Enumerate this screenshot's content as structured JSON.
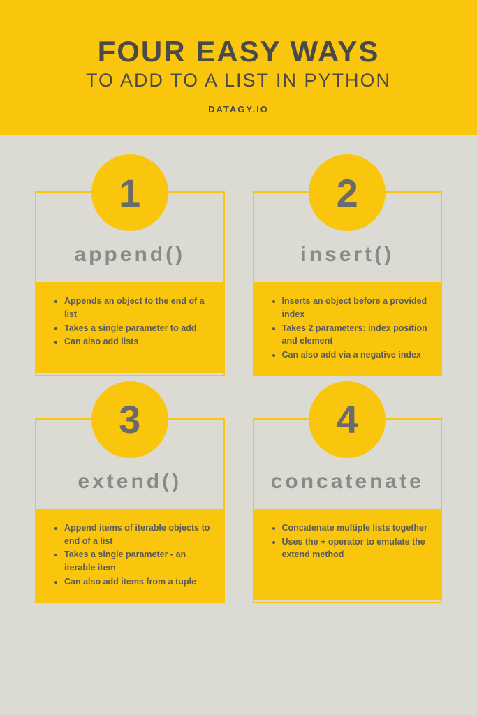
{
  "header": {
    "title": "FOUR EASY WAYS",
    "subtitle": "TO ADD TO A LIST IN PYTHON",
    "site": "DATAGY.IO"
  },
  "cards": [
    {
      "num": "1",
      "method": "append()",
      "points": [
        "Appends an object to the end of a list",
        "Takes a single parameter to add",
        "Can also add lists"
      ]
    },
    {
      "num": "2",
      "method": "insert()",
      "points": [
        "Inserts an object before a provided index",
        "Takes 2 parameters: index position and element",
        "Can also add via a negative index"
      ]
    },
    {
      "num": "3",
      "method": "extend()",
      "points": [
        "Append items of iterable objects to end of a list",
        "Takes a single parameter - an iterable item",
        "Can also add items from a tuple"
      ]
    },
    {
      "num": "4",
      "method": "concatenate",
      "points": [
        "Concatenate multiple lists together",
        "Uses the + operator to emulate the extend method"
      ]
    }
  ]
}
